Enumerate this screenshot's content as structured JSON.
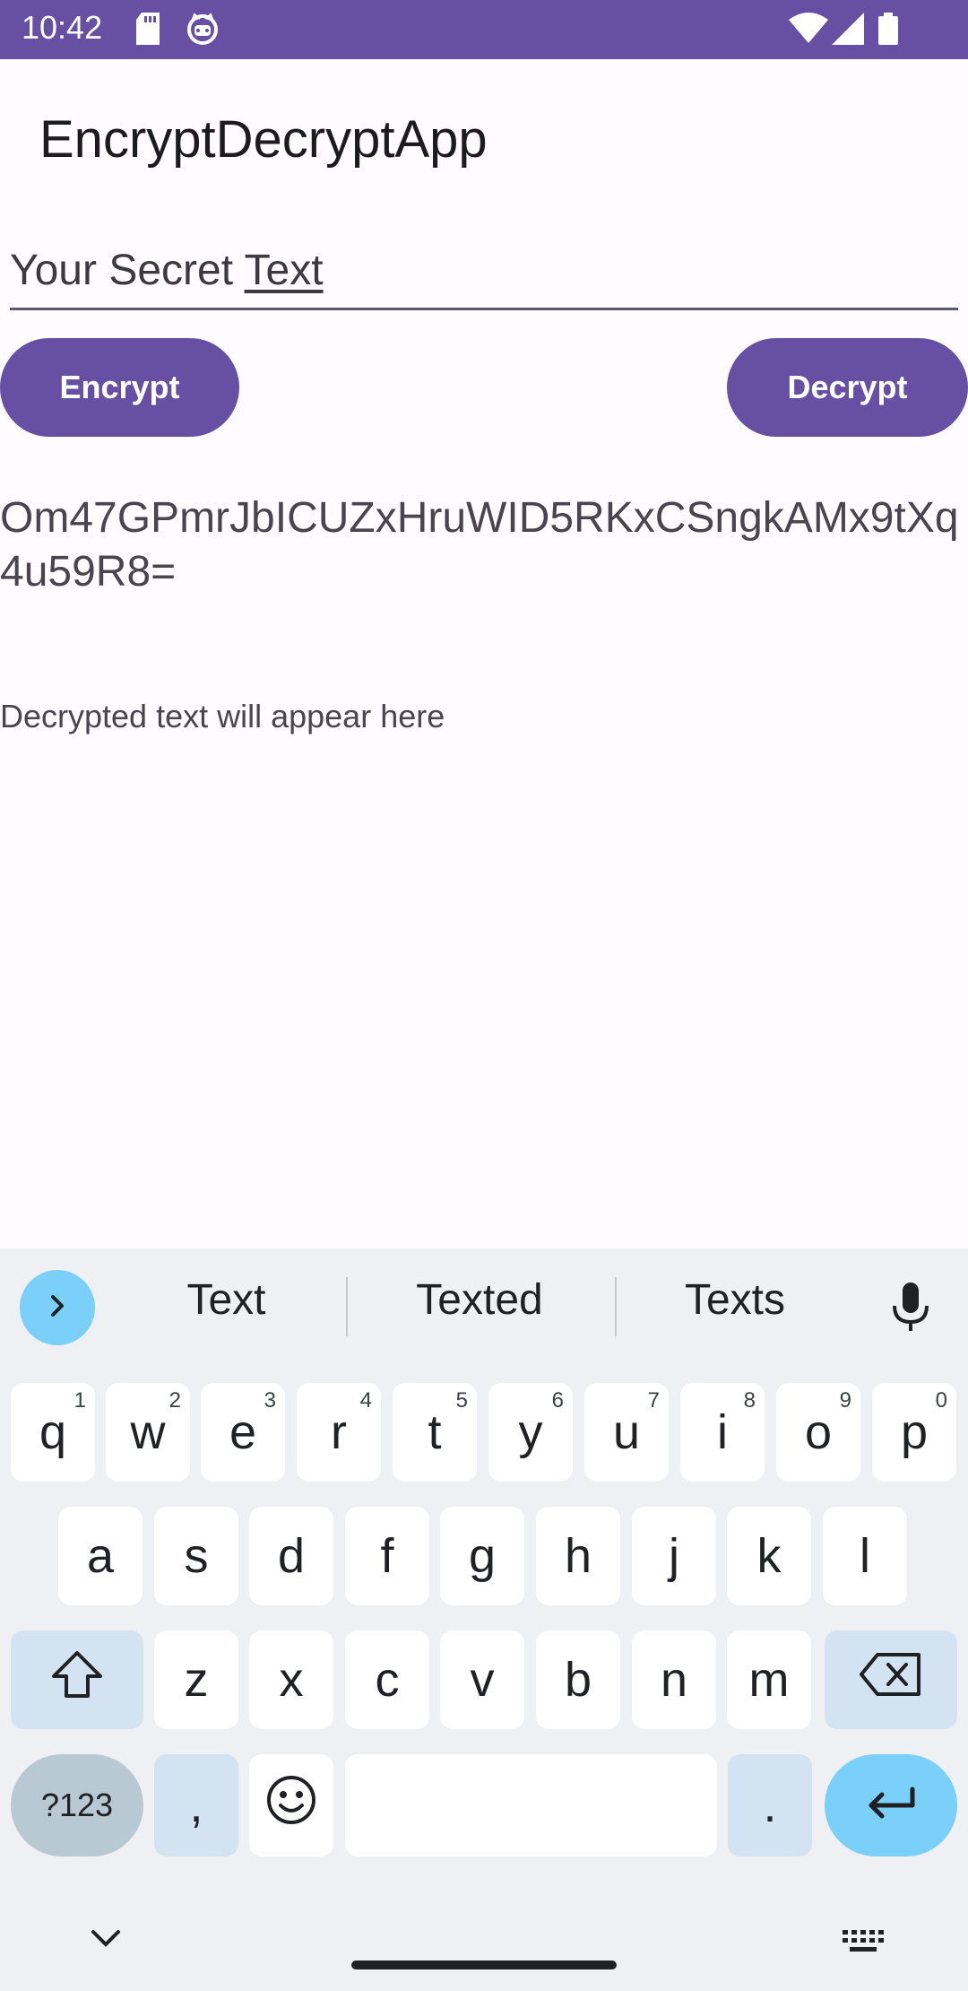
{
  "status_bar": {
    "time": "10:42",
    "icons": [
      "sd-card-icon",
      "cat-face-icon",
      "wifi-icon",
      "signal-icon",
      "battery-icon"
    ]
  },
  "app": {
    "title": "EncryptDecryptApp",
    "input": {
      "value_plain": "Your Secret ",
      "value_composing": "Text"
    },
    "encrypt_label": "Encrypt",
    "decrypt_label": "Decrypt",
    "encrypted_output": "Om47GPmrJbICUZxHruWID5RKxCSngkAMx9tXq4u59R8=",
    "decrypted_output": "Decrypted text will appear here"
  },
  "keyboard": {
    "suggestions": [
      "Text",
      "Texted",
      "Texts"
    ],
    "row1": [
      {
        "k": "q",
        "n": "1"
      },
      {
        "k": "w",
        "n": "2"
      },
      {
        "k": "e",
        "n": "3"
      },
      {
        "k": "r",
        "n": "4"
      },
      {
        "k": "t",
        "n": "5"
      },
      {
        "k": "y",
        "n": "6"
      },
      {
        "k": "u",
        "n": "7"
      },
      {
        "k": "i",
        "n": "8"
      },
      {
        "k": "o",
        "n": "9"
      },
      {
        "k": "p",
        "n": "0"
      }
    ],
    "row2": [
      "a",
      "s",
      "d",
      "f",
      "g",
      "h",
      "j",
      "k",
      "l"
    ],
    "row3": [
      "z",
      "x",
      "c",
      "v",
      "b",
      "n",
      "m"
    ],
    "symbols_label": "?123",
    "comma_label": ",",
    "period_label": "."
  },
  "colors": {
    "primary": "#6750a4",
    "background": "#fffbfe",
    "keyboard_bg": "#eef0f3",
    "accent_blue": "#7ad0f8"
  }
}
